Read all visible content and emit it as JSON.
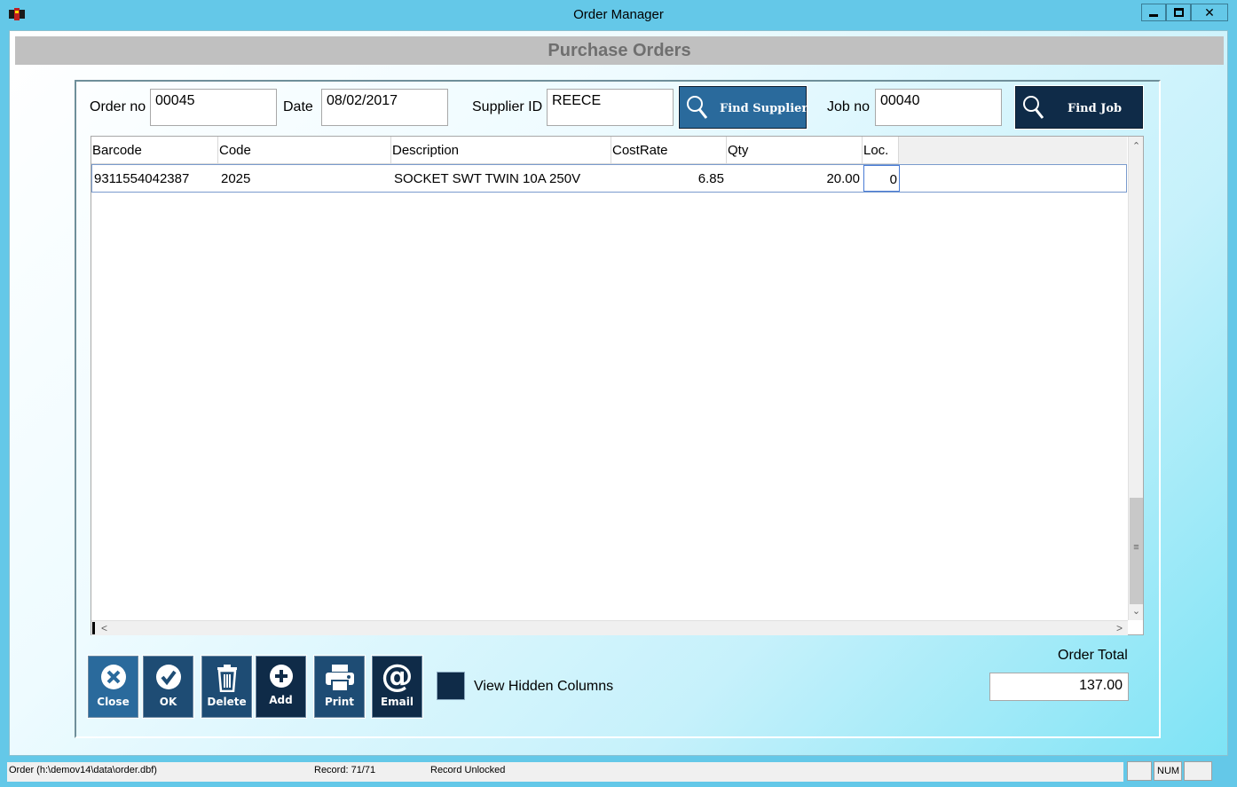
{
  "window": {
    "title": "Order Manager",
    "close_glyph": "✕",
    "icon": "app-icon"
  },
  "header": {
    "title": "Purchase Orders"
  },
  "form": {
    "order_no_label": "Order no",
    "order_no": "00045",
    "date_label": "Date",
    "date": "08/02/2017",
    "supplier_label": "Supplier ID",
    "supplier_id": "REECE",
    "find_supplier_label": "Find Supplier",
    "job_no_label": "Job no",
    "job_no": "00040",
    "find_job_label": "Find Job"
  },
  "grid": {
    "columns": [
      "Barcode",
      "Code",
      "Description",
      "CostRate",
      "Qty",
      "Loc."
    ],
    "rows": [
      {
        "barcode": "9311554042387",
        "code": "2025",
        "description": "SOCKET SWT TWIN 10A 250V",
        "costrate": "6.85",
        "qty": "20.00",
        "loc": "0"
      }
    ],
    "scroll": {
      "up": "⌄",
      "down": "⌄",
      "left": "<",
      "right": ">",
      "grip": "≡"
    }
  },
  "toolbar": {
    "close_label": "Close",
    "ok_label": "OK",
    "delete_label": "Delete",
    "add_label": "Add",
    "print_label": "Print",
    "email_label": "Email",
    "email_glyph": "@"
  },
  "view_hidden_columns_label": "View Hidden Columns",
  "order_total": {
    "label": "Order Total",
    "value": "137.00"
  },
  "status": {
    "file": "Order (h:\\demov14\\data\\order.dbf)",
    "record": "Record: 71/71",
    "lock": "Record Unlocked",
    "num": "NUM"
  },
  "colors": {
    "titlebar": "#64c8e8",
    "button_dark": "#0f2b48",
    "button_mid": "#2a6a9c",
    "header_text": "#6f6f6f"
  }
}
